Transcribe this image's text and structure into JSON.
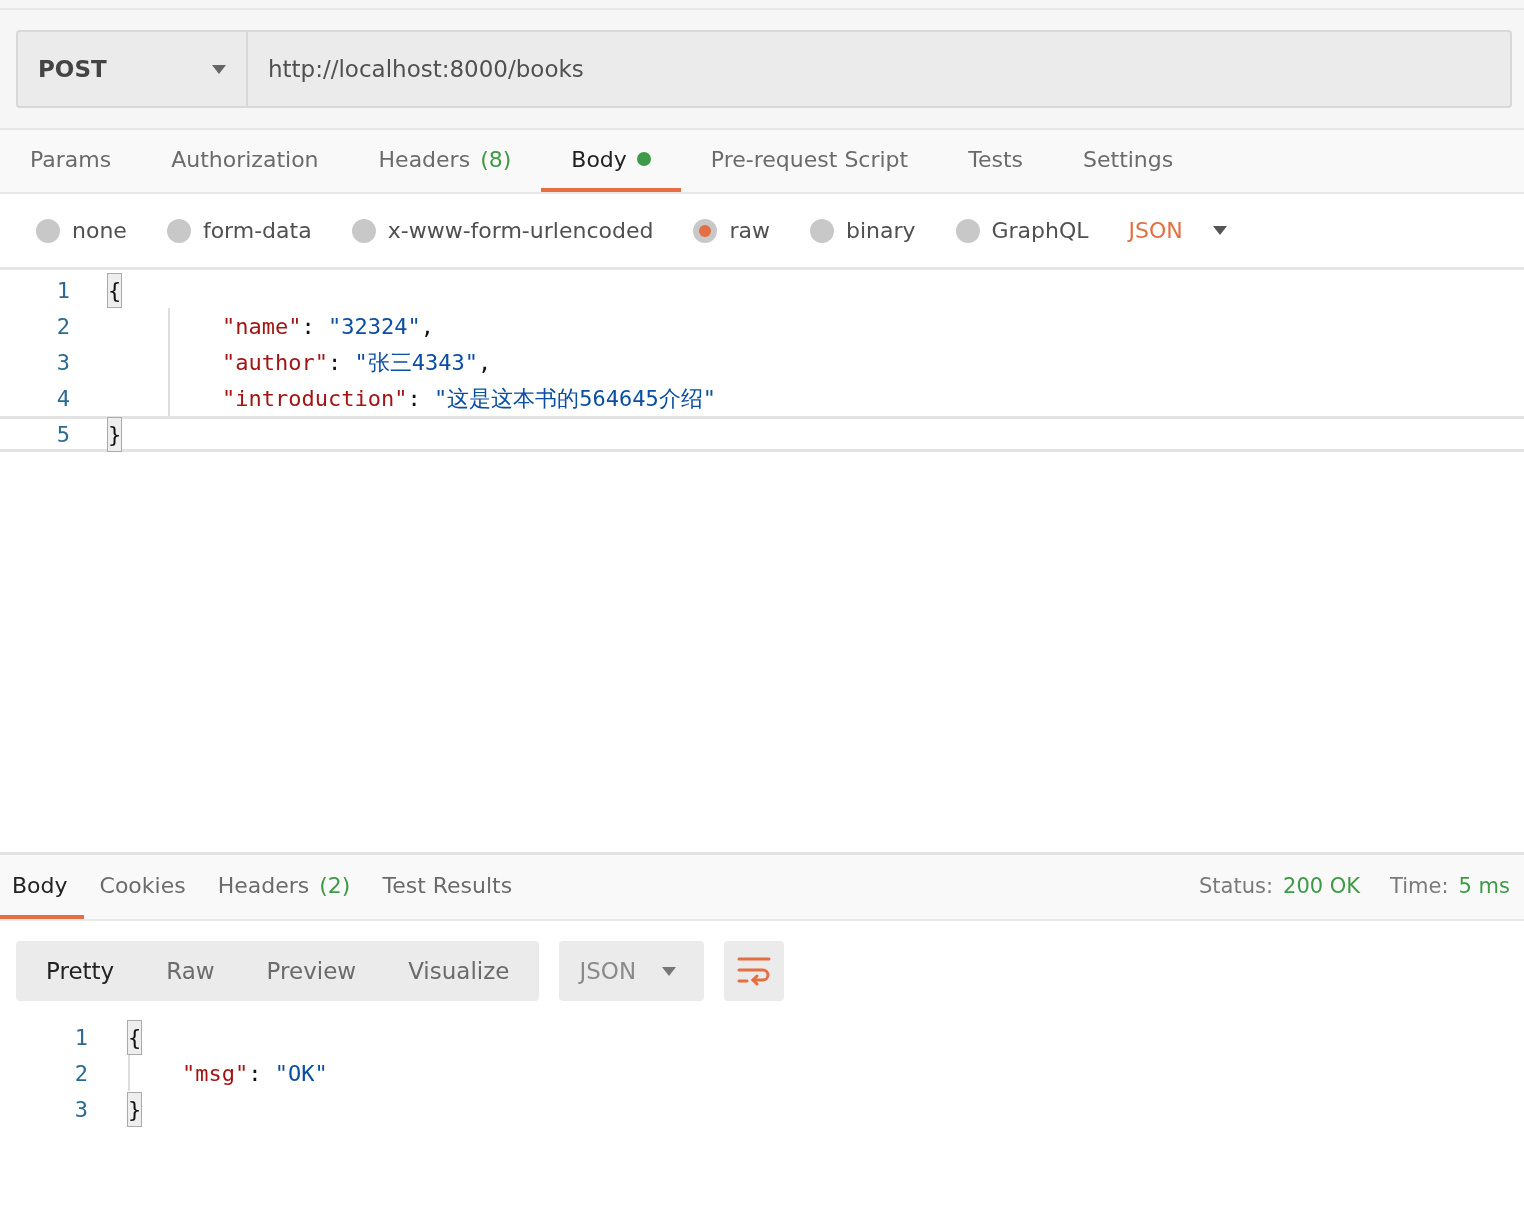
{
  "request": {
    "method": "POST",
    "url": "http://localhost:8000/books"
  },
  "request_tabs": [
    {
      "label": "Params",
      "selected": false
    },
    {
      "label": "Authorization",
      "selected": false
    },
    {
      "label": "Headers",
      "count": "(8)",
      "selected": false
    },
    {
      "label": "Body",
      "has_content": true,
      "selected": true
    },
    {
      "label": "Pre-request Script",
      "selected": false
    },
    {
      "label": "Tests",
      "selected": false
    },
    {
      "label": "Settings",
      "selected": false
    }
  ],
  "body_types": [
    {
      "label": "none",
      "selected": false
    },
    {
      "label": "form-data",
      "selected": false
    },
    {
      "label": "x-www-form-urlencoded",
      "selected": false
    },
    {
      "label": "raw",
      "selected": true
    },
    {
      "label": "binary",
      "selected": false
    },
    {
      "label": "GraphQL",
      "selected": false
    }
  ],
  "raw_format": "JSON",
  "request_body": [
    {
      "number": "1",
      "active": false,
      "tokens": [
        {
          "kind": "bracket",
          "text": "{"
        }
      ]
    },
    {
      "number": "2",
      "active": false,
      "indent": true,
      "tokens": [
        {
          "kind": "key",
          "text": "\"name\""
        },
        {
          "kind": "punct",
          "text": ": "
        },
        {
          "kind": "string",
          "text": "\"32324\""
        },
        {
          "kind": "punct",
          "text": ","
        }
      ]
    },
    {
      "number": "3",
      "active": false,
      "indent": true,
      "tokens": [
        {
          "kind": "key",
          "text": "\"author\""
        },
        {
          "kind": "punct",
          "text": ": "
        },
        {
          "kind": "string",
          "text": "\"张三4343\""
        },
        {
          "kind": "punct",
          "text": ","
        }
      ]
    },
    {
      "number": "4",
      "active": false,
      "indent": true,
      "tokens": [
        {
          "kind": "key",
          "text": "\"introduction\""
        },
        {
          "kind": "punct",
          "text": ": "
        },
        {
          "kind": "string",
          "text": "\"这是这本书的564645介绍\""
        }
      ]
    },
    {
      "number": "5",
      "active": true,
      "tokens": [
        {
          "kind": "bracket",
          "text": "}"
        }
      ]
    }
  ],
  "response_tabs": [
    {
      "label": "Body",
      "selected": true
    },
    {
      "label": "Cookies",
      "selected": false
    },
    {
      "label": "Headers",
      "count": "(2)",
      "selected": false
    },
    {
      "label": "Test Results",
      "selected": false
    }
  ],
  "status": {
    "label": "Status:",
    "value": "200 OK"
  },
  "time": {
    "label": "Time:",
    "value": "5 ms"
  },
  "view_modes": [
    {
      "label": "Pretty",
      "selected": true
    },
    {
      "label": "Raw",
      "selected": false
    },
    {
      "label": "Preview",
      "selected": false
    },
    {
      "label": "Visualize",
      "selected": false
    }
  ],
  "response_format": "JSON",
  "response_body": [
    {
      "number": "1",
      "active": false,
      "tokens": [
        {
          "kind": "bracket",
          "text": "{"
        }
      ]
    },
    {
      "number": "2",
      "active": false,
      "indent": true,
      "tokens": [
        {
          "kind": "key",
          "text": "\"msg\""
        },
        {
          "kind": "punct",
          "text": ": "
        },
        {
          "kind": "string",
          "text": "\"OK\""
        }
      ]
    },
    {
      "number": "3",
      "active": false,
      "tokens": [
        {
          "kind": "bracket",
          "text": "}"
        }
      ]
    }
  ]
}
